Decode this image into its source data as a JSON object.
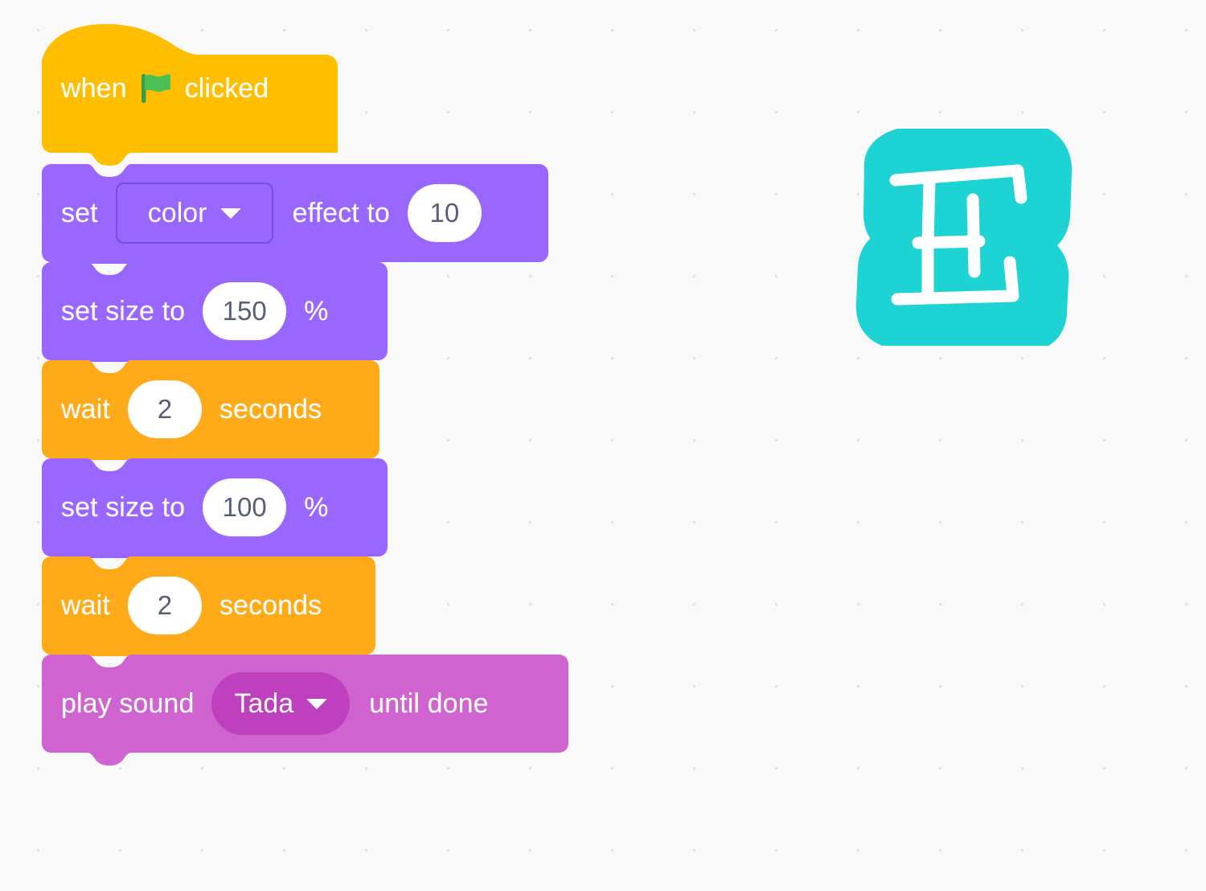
{
  "workspace": {
    "name": "block-code-workspace",
    "background_color": "#f9f9f9",
    "grid_dot_color": "#e0e0e0",
    "grid_spacing_px": 102
  },
  "palette": {
    "events_yellow": "#ffbf00",
    "looks_purple": "#9966ff",
    "control_orange": "#ffab19",
    "sound_magenta": "#cf63cf",
    "sound_magenta_dark": "#bf40bf",
    "input_white": "#ffffff",
    "input_text": "#575e75",
    "flag_green": "#4cbf56"
  },
  "script": {
    "name": "main-script-stack",
    "blocks": [
      {
        "id": "when-flag-clicked",
        "kind": "hat",
        "category": "events",
        "color": "#ffbf00",
        "text_before": "when",
        "icon": "green-flag-icon",
        "text_after": "clicked"
      },
      {
        "id": "set-color-effect",
        "kind": "stack",
        "category": "looks",
        "color": "#9966ff",
        "text_before": "set",
        "dropdown_value": "color",
        "text_middle": "effect to",
        "input_value": "10"
      },
      {
        "id": "set-size-150",
        "kind": "stack",
        "category": "looks",
        "color": "#9966ff",
        "text_before": "set size to",
        "input_value": "150",
        "text_after": "%"
      },
      {
        "id": "wait-2-seconds-first",
        "kind": "stack",
        "category": "control",
        "color": "#ffab19",
        "text_before": "wait",
        "input_value": "2",
        "text_after": "seconds"
      },
      {
        "id": "set-size-100",
        "kind": "stack",
        "category": "looks",
        "color": "#9966ff",
        "text_before": "set size to",
        "input_value": "100",
        "text_after": "%"
      },
      {
        "id": "wait-2-seconds-second",
        "kind": "stack",
        "category": "control",
        "color": "#ffab19",
        "text_before": "wait",
        "input_value": "2",
        "text_after": "seconds"
      },
      {
        "id": "play-sound-until-done",
        "kind": "stack",
        "category": "sound",
        "color": "#cf63cf",
        "text_before": "play sound",
        "dropdown_value": "Tada",
        "text_after": "until done"
      }
    ]
  },
  "sprite": {
    "name": "letter-e-sprite",
    "color": "#1dd3d3",
    "outline_color": "#ffffff",
    "label": "E"
  }
}
